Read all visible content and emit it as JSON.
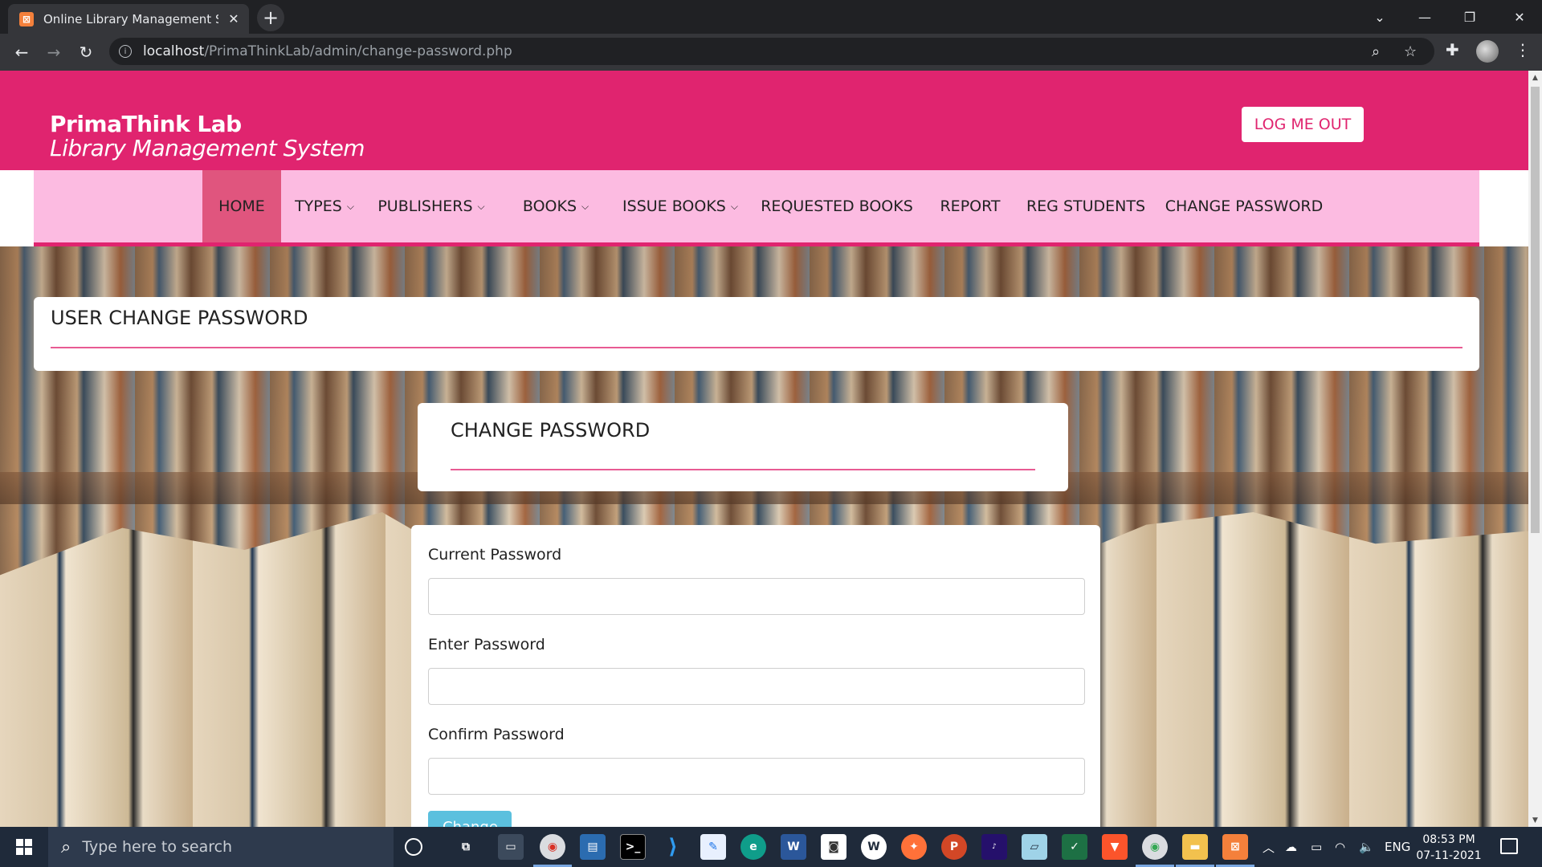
{
  "browser": {
    "tab_title": "Online Library Management System",
    "tab_favicon": "xampp-icon",
    "url_host": "localhost",
    "url_path": "/PrimaThinkLab/admin/change-password.php",
    "new_tab_symbol": "+",
    "close_tab_symbol": "✕"
  },
  "header": {
    "brand_name": "PrimaThink Lab",
    "brand_subtitle": "Library Management System",
    "logout_label": "LOG ME OUT",
    "accent_color": "#e0246f"
  },
  "nav": {
    "items": [
      {
        "label": "HOME",
        "active": true,
        "dropdown": false
      },
      {
        "label": "TYPES",
        "active": false,
        "dropdown": true
      },
      {
        "label": "PUBLISHERS",
        "active": false,
        "dropdown": true
      },
      {
        "label": "BOOKS",
        "active": false,
        "dropdown": true
      },
      {
        "label": "ISSUE BOOKS",
        "active": false,
        "dropdown": true
      },
      {
        "label": "REQUESTED BOOKS",
        "active": false,
        "dropdown": false
      },
      {
        "label": "REPORT",
        "active": false,
        "dropdown": false
      },
      {
        "label": "REG STUDENTS",
        "active": false,
        "dropdown": false
      },
      {
        "label": "CHANGE PASSWORD",
        "active": false,
        "dropdown": false
      }
    ]
  },
  "page": {
    "section_title": "USER CHANGE PASSWORD",
    "card_title": "CHANGE PASSWORD",
    "fields": [
      {
        "label": "Current Password",
        "value": ""
      },
      {
        "label": "Enter Password",
        "value": ""
      },
      {
        "label": "Confirm Password",
        "value": ""
      }
    ],
    "submit_label": "Change"
  },
  "taskbar": {
    "search_placeholder": "Type here to search",
    "language": "ENG",
    "time": "08:53 PM",
    "date": "07-11-2021"
  }
}
